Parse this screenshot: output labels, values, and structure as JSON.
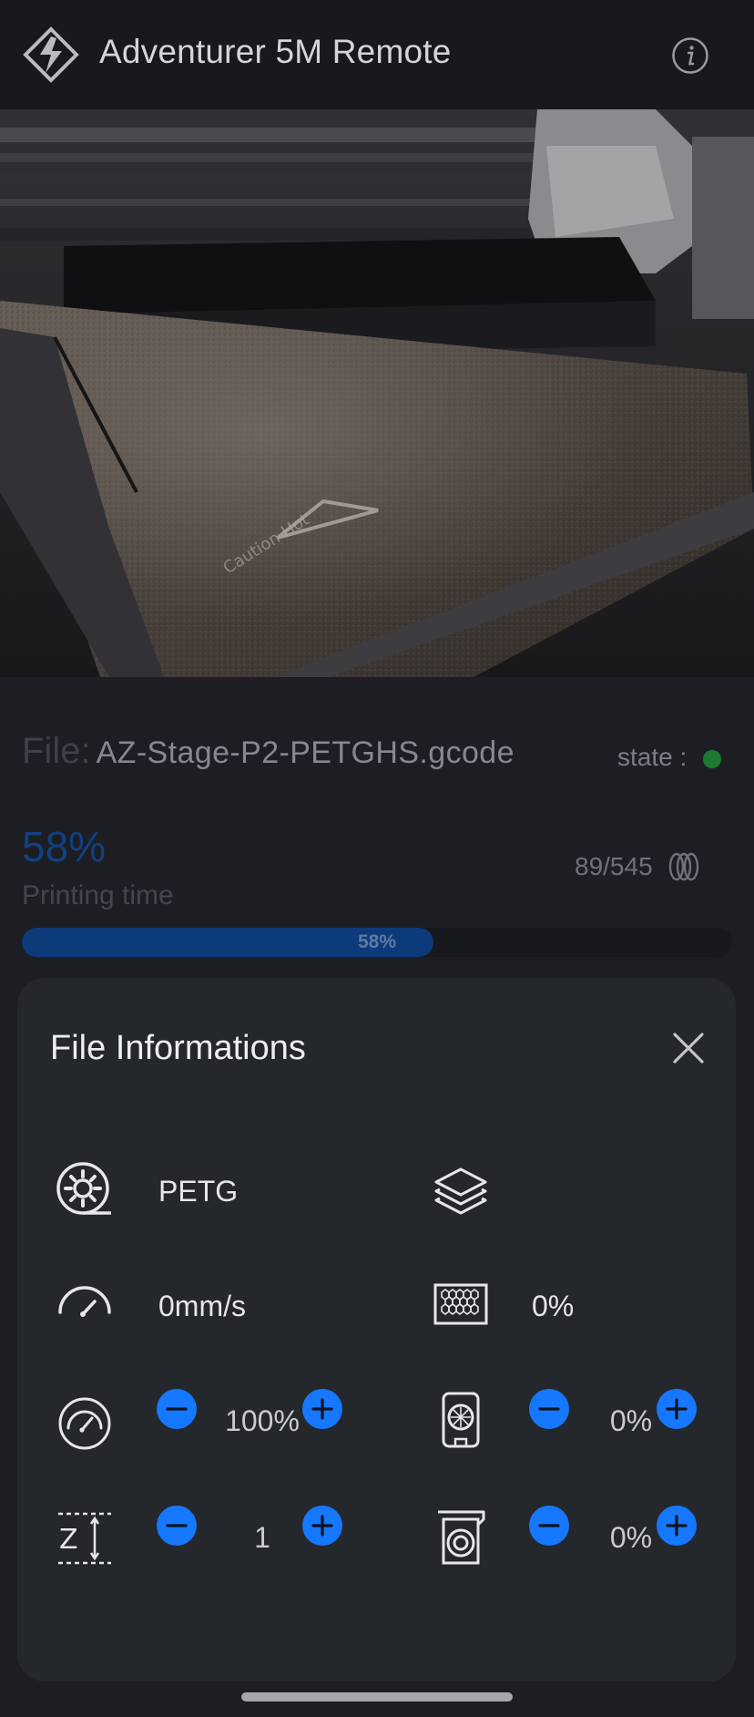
{
  "header": {
    "title": "Adventurer 5M Remote",
    "logo_icon": "flashforge-logo",
    "info_icon": "info-icon"
  },
  "status": {
    "file_label": "File:",
    "file_name": "AZ-Stage-P2-PETGHS.gcode",
    "state_label": "state :",
    "state_color": "#1d7a34",
    "progress_percent": "58%",
    "progress_value": 0.58,
    "printing_time_label": "Printing time",
    "layers": "89/545",
    "progress_bar_label": "58%"
  },
  "sheet": {
    "title": "File Informations",
    "close_icon": "close-icon",
    "material": "PETG",
    "speed": "0mm/s",
    "infill": "0%",
    "speed_override": "100%",
    "z_offset": "1",
    "chamber_fan": "0%",
    "aux_fan": "0%"
  },
  "colors": {
    "accent": "#1677ff",
    "background": "#191b20",
    "sheet": "#24272c"
  }
}
